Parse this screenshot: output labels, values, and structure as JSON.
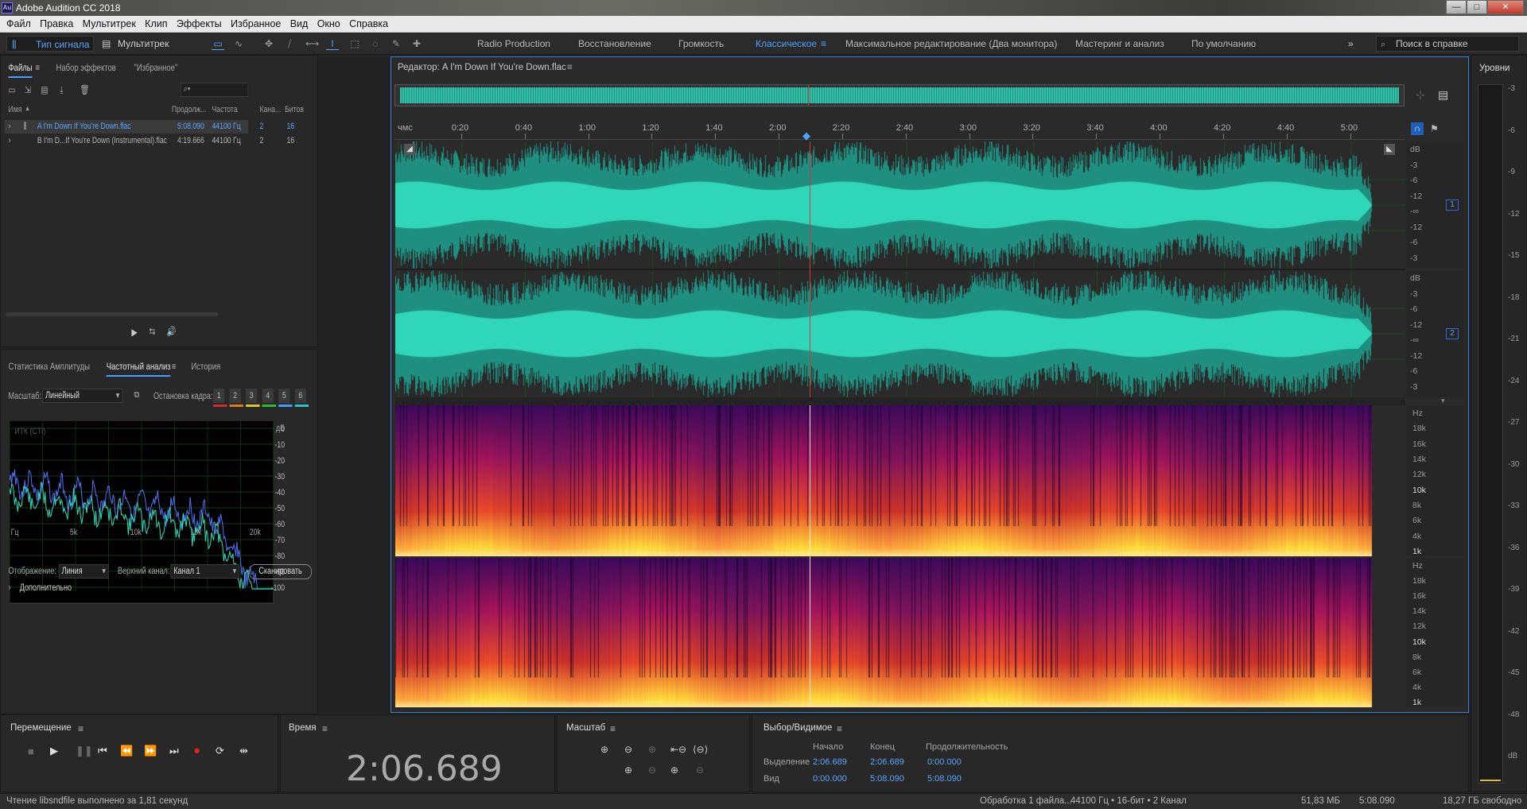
{
  "window": {
    "title": "Adobe Audition CC 2018",
    "logo": "Au",
    "minimize": "—",
    "maximize": "□",
    "close": "✕"
  },
  "menu": [
    "Файл",
    "Правка",
    "Мультитрек",
    "Клип",
    "Эффекты",
    "Избранное",
    "Вид",
    "Окно",
    "Справка"
  ],
  "modes": {
    "waveform": "Тип сигнала",
    "multitrack": "Мультитрек"
  },
  "workspaces": [
    "Radio Production",
    "Восстановление",
    "Громкость",
    "Классическое",
    "Максимальное редактирование (Два монитора)",
    "Мастеринг и анализ",
    "По умолчанию"
  ],
  "active_workspace": "Классическое",
  "search_help": "Поиск в справке",
  "files_panel": {
    "tabs": [
      "Файлы",
      "Набор эффектов",
      "\"Избранное\""
    ],
    "columns": [
      "Имя",
      "Продолж...",
      "Частота",
      "Кана...",
      "Битов"
    ],
    "rows": [
      {
        "name": "A I'm Down If You're Down.flac",
        "duration": "5:08.090",
        "rate": "44100 Гц",
        "channels": "2",
        "bits": "16"
      },
      {
        "name": "B I'm D...If You're Down (Instrumental).flac",
        "duration": "4:19.666",
        "rate": "44100 Гц",
        "channels": "2",
        "bits": "16"
      }
    ]
  },
  "analysis_panel": {
    "tabs": [
      "Статистика Амплитуды",
      "Частотный анализ",
      "История"
    ],
    "scale_label": "Масштаб:",
    "scale_value": "Линейный",
    "freeze_label": "Остановка кадра:",
    "freeze_buttons": [
      "1",
      "2",
      "3",
      "4",
      "5",
      "6"
    ],
    "freeze_colors": [
      "#d42b2b",
      "#e07a1a",
      "#e0c51a",
      "#2bbd2b",
      "#3b9bff",
      "#23c6c6"
    ],
    "graph_label": "ИТК (CTI)",
    "db_label": "дБ",
    "db_ticks": [
      "0",
      "-10",
      "-20",
      "-30",
      "-40",
      "-50",
      "-60",
      "-70",
      "-80",
      "-90",
      "-100"
    ],
    "freq_ticks": [
      "Гц",
      "5k",
      "10k",
      "15k",
      "20k"
    ],
    "display_label": "Отображение:",
    "display_value": "Линия",
    "channel_label": "Верхний канал:",
    "channel_value": "Канал 1",
    "scan_button": "Сканировать",
    "advanced": "Дополнительно"
  },
  "editor": {
    "title": "Редактор: A I'm Down If You're Down.flac",
    "time_unit": "чмс",
    "time_ticks": [
      "0:20",
      "0:40",
      "1:00",
      "1:20",
      "1:40",
      "2:00",
      "2:20",
      "2:40",
      "3:00",
      "3:20",
      "3:40",
      "4:00",
      "4:20",
      "4:40",
      "5:00"
    ],
    "db_scale": [
      "dB",
      "-3",
      "-6",
      "-12",
      "-∞",
      "-12",
      "-6",
      "-3"
    ],
    "channels": [
      "1",
      "2"
    ],
    "hz_scale": [
      "Hz",
      "18k",
      "16k",
      "14k",
      "12k",
      "10k",
      "8k",
      "6k",
      "4k",
      "1k"
    ]
  },
  "levels": {
    "title": "Уровни",
    "ticks": [
      "-3",
      "-6",
      "-9",
      "-12",
      "-15",
      "-18",
      "-21",
      "-24",
      "-27",
      "-30",
      "-33",
      "-36",
      "-39",
      "-42",
      "-45",
      "-48",
      "dB"
    ]
  },
  "transport": {
    "title": "Перемещение"
  },
  "time": {
    "title": "Время",
    "value": "2:06.689"
  },
  "zoom": {
    "title": "Масштаб"
  },
  "selection": {
    "title": "Выбор/Видимое",
    "cols": [
      "Начало",
      "Конец",
      "Продолжительность"
    ],
    "rows": [
      {
        "label": "Выделение",
        "start": "2:06.689",
        "end": "2:06.689",
        "duration": "0:00.000"
      },
      {
        "label": "Вид",
        "start": "0:00.000",
        "end": "5:08.090",
        "duration": "5:08.090"
      }
    ]
  },
  "status": {
    "left": "Чтение libsndfile выполнено за 1,81 секунд",
    "processing": "Обработка 1 файла...",
    "format": "44100 Гц • 16-бит • 2 Канал",
    "size": "51,83 МБ",
    "duration": "5:08.090",
    "free": "18,27 ГБ свободно"
  },
  "colors": {
    "accent": "#4fa3ff",
    "waveform": "#2fd6b8",
    "playhead": "#d23a3a"
  }
}
